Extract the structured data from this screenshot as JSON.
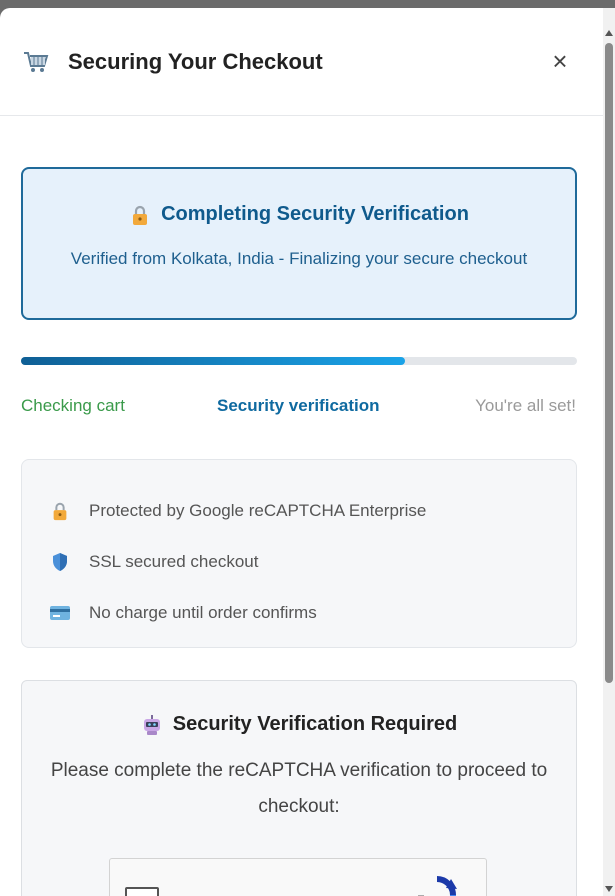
{
  "header": {
    "title": "Securing Your Checkout",
    "close_label": "×",
    "icon": "shopping-cart-icon"
  },
  "status": {
    "title": "Completing Security Verification",
    "subtitle": "Verified from Kolkata, India - Finalizing your secure checkout",
    "icon": "lock-icon",
    "accent_color": "#0f5a8c",
    "background_color": "#e6f1fb"
  },
  "progress": {
    "percent": 69,
    "steps": [
      {
        "label": "Checking cart",
        "state": "done",
        "color": "#3a9a4a"
      },
      {
        "label": "Security verification",
        "state": "active",
        "color": "#0f6aa0"
      },
      {
        "label": "You're all set!",
        "state": "pending",
        "color": "#9a9a9a"
      }
    ]
  },
  "features": [
    {
      "icon": "lock-icon",
      "label": "Protected by Google reCAPTCHA Enterprise"
    },
    {
      "icon": "shield-icon",
      "label": "SSL secured checkout"
    },
    {
      "icon": "credit-card-icon",
      "label": "No charge until order confirms"
    }
  ],
  "verification": {
    "icon": "robot-icon",
    "title": "Security Verification Required",
    "description": "Please complete the reCAPTCHA verification to proceed to checkout:"
  },
  "recaptcha": {
    "checked": false,
    "logo": "recaptcha-logo-icon"
  }
}
